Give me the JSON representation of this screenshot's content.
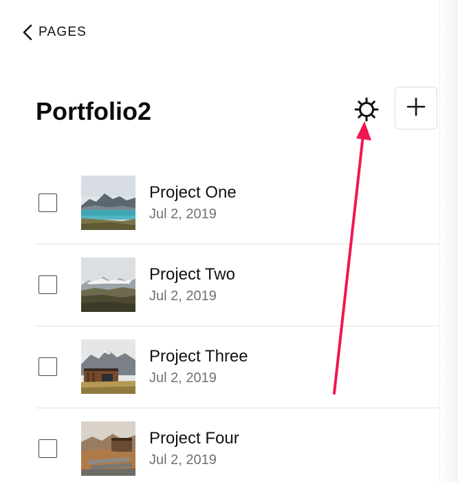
{
  "nav": {
    "back_label": "PAGES",
    "back_icon": "chevron-left-icon"
  },
  "header": {
    "title": "Portfolio2",
    "settings_icon": "gear-icon",
    "add_icon": "plus-icon"
  },
  "pages": [
    {
      "title": "Project One",
      "date": "Jul 2, 2019",
      "checked": false
    },
    {
      "title": "Project Two",
      "date": "Jul 2, 2019",
      "checked": false
    },
    {
      "title": "Project Three",
      "date": "Jul 2, 2019",
      "checked": false
    },
    {
      "title": "Project Four",
      "date": "Jul 2, 2019",
      "checked": false
    }
  ],
  "colors": {
    "annotation_arrow": "#f0174f",
    "text_primary": "#111111",
    "text_secondary": "#6f6f6f"
  }
}
